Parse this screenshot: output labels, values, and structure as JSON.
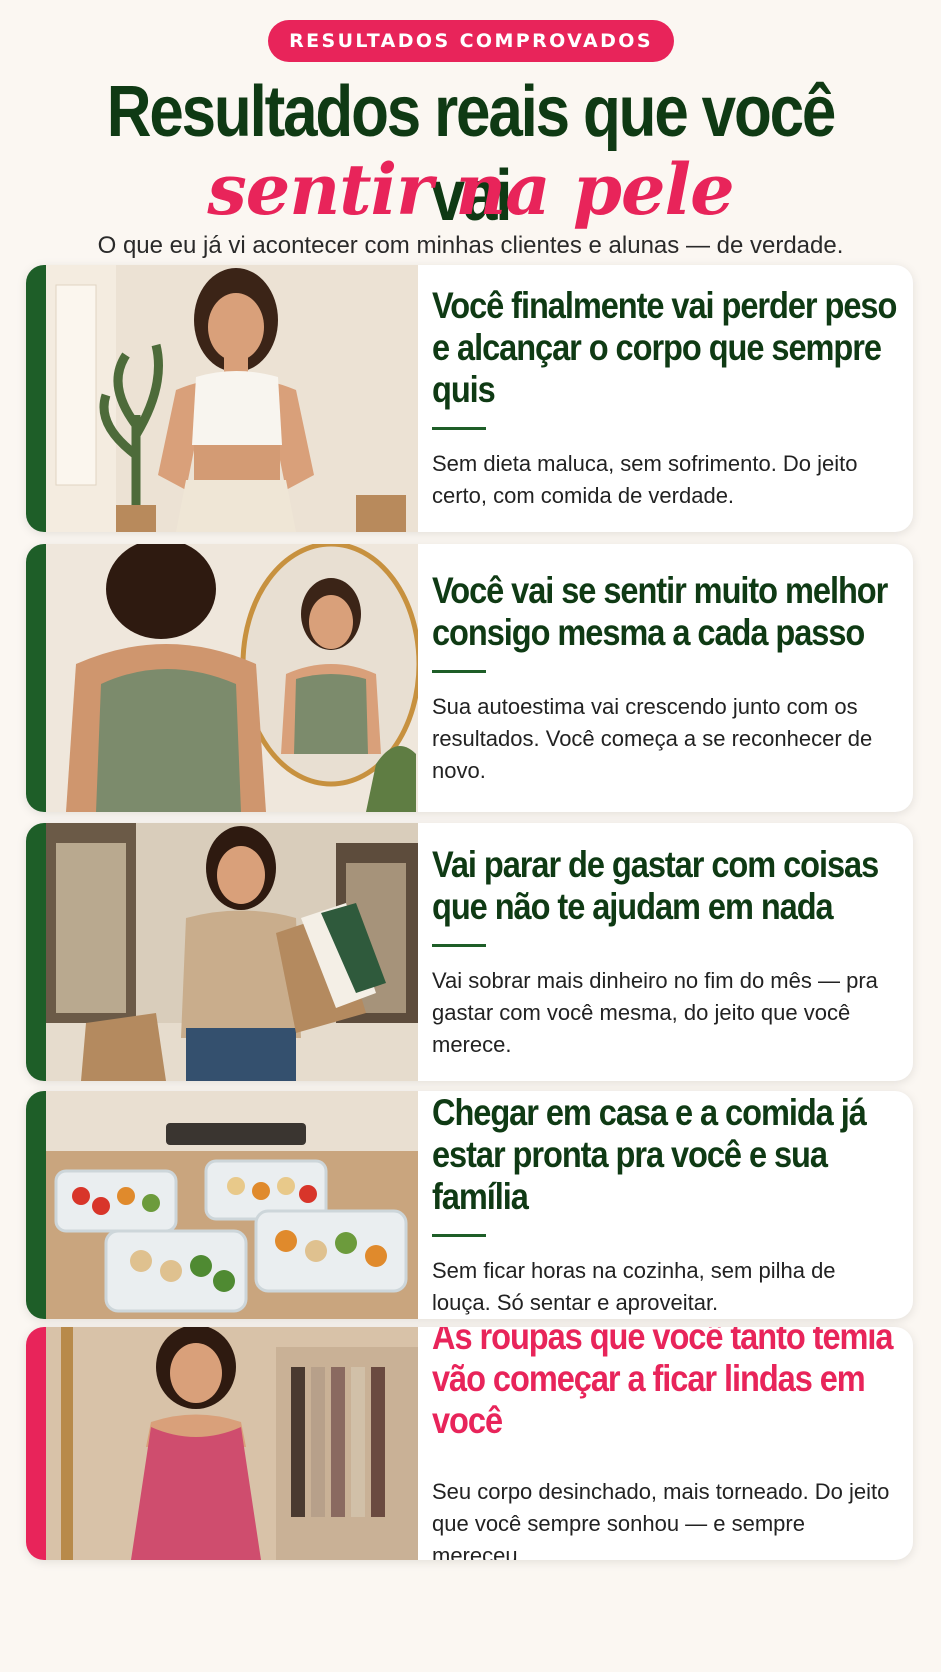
{
  "header": {
    "badge": "RESULTADOS COMPROVADOS",
    "title_line1": "Resultados reais que você vai",
    "title_line2": "sentir na pele",
    "subtitle": "O que eu já vi acontecer com minhas clientes e alunas — de verdade."
  },
  "colors": {
    "dark_green": "#0f3a14",
    "accent_green": "#1e5e28",
    "pink": "#e8245a",
    "background": "#fbf7f2"
  },
  "cards": [
    {
      "title": "Você finalmente vai perder peso e alcançar o corpo que sempre quis",
      "text": "Sem dieta maluca, sem sofrimento. Do jeito certo, com comida de verdade.",
      "image": "woman-fitness-photo"
    },
    {
      "title": "Você vai se sentir muito melhor consigo mesma a cada passo",
      "text": "Sua autoestima vai crescendo junto com os resultados. Você começa a se reconhecer de novo.",
      "image": "woman-mirror-photo"
    },
    {
      "title": "Vai parar de gastar com coisas que não te ajudam em nada",
      "text": "Vai sobrar mais dinheiro no fim do mês — pra gastar com você mesma, do jeito que você merece.",
      "image": "woman-shopping-photo"
    },
    {
      "title": "Chegar em casa e a comida já estar pronta pra você e sua família",
      "text": "Sem ficar horas na cozinha, sem pilha de louça. Só sentar e aproveitar.",
      "image": "meal-prep-photo"
    },
    {
      "title": "As roupas que você tanto temia vão começar a ficar lindas em você",
      "text": "Seu corpo desinchado, mais torneado. Do jeito que você sempre sonhou — e sempre mereceu.",
      "image": "woman-dress-photo"
    }
  ]
}
